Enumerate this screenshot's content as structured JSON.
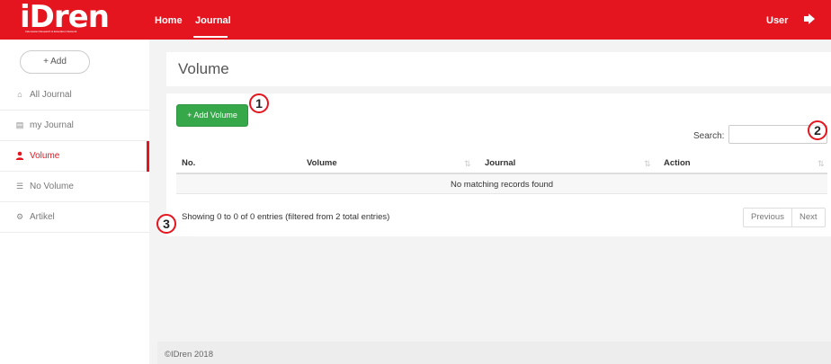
{
  "brand": {
    "logo_text": "iDren",
    "logo_tagline": "Indonesian Research & Education Network",
    "primary_color": "#e5151f",
    "success_color": "#37a84a"
  },
  "topnav": {
    "items": [
      {
        "label": "Home"
      },
      {
        "label": "Journal"
      }
    ],
    "active_item": "Journal",
    "user_label": "User",
    "logout_icon": "sign-out-icon"
  },
  "sidebar": {
    "add_button_label": "+ Add",
    "items": [
      {
        "label": "All Journal",
        "icon": "home-icon"
      },
      {
        "label": "my Journal",
        "icon": "book-icon"
      },
      {
        "label": "Volume",
        "icon": "user-icon"
      },
      {
        "label": "No Volume",
        "icon": "list-icon"
      },
      {
        "label": "Artikel",
        "icon": "gear-icon"
      }
    ],
    "active_item": "Volume"
  },
  "main": {
    "page_title": "Volume",
    "add_volume_label": "+ Add Volume",
    "search_label": "Search:",
    "search_value": "",
    "table": {
      "columns": [
        "No.",
        "Volume",
        "Journal",
        "Action"
      ],
      "rows": [],
      "empty_message": "No matching records found"
    },
    "info_text": "Showing 0 to 0 of 0 entries (filtered from 2 total entries)",
    "pagination": {
      "previous_label": "Previous",
      "next_label": "Next"
    }
  },
  "footer": {
    "text": "©IDren 2018"
  },
  "callouts": [
    "1",
    "2",
    "3"
  ]
}
